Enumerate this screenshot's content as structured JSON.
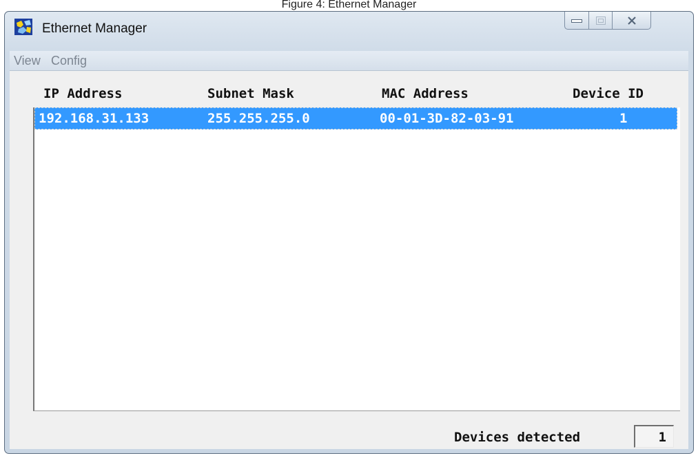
{
  "caption": "Figure 4: Ethernet Manager",
  "window": {
    "title": "Ethernet Manager",
    "app_icon": "ethernet-manager-icon",
    "controls": {
      "minimize_icon": "minimize-icon",
      "maximize_icon": "maximize-icon",
      "close_icon": "close-icon"
    }
  },
  "menu": {
    "items": [
      "View",
      "Config"
    ]
  },
  "table": {
    "columns": [
      "IP Address",
      "Subnet Mask",
      "MAC Address",
      "Device ID"
    ],
    "rows": [
      {
        "ip": "192.168.31.133",
        "subnet": "255.255.255.0",
        "mac": "00-01-3D-82-03-91",
        "device_id": "1",
        "selected": true
      }
    ]
  },
  "status": {
    "label": "Devices detected",
    "count": "1"
  },
  "colors": {
    "selection": "#3399ff",
    "frame": "#cfdbe8"
  }
}
